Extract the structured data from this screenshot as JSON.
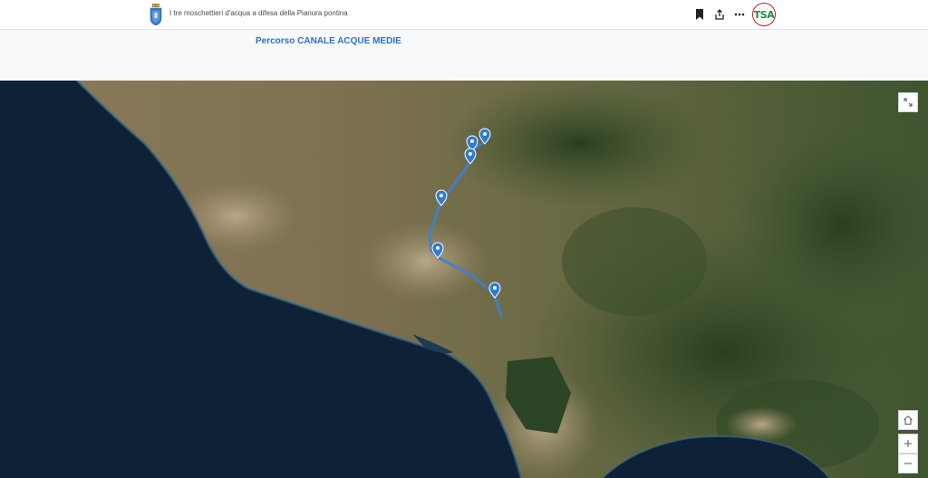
{
  "header": {
    "site_title": "I tre moschettieri d'acqua a difesa della Pianura pontina",
    "logo_text": "TSA",
    "icons": [
      "bookmark-icon",
      "share-icon",
      "more-icon"
    ]
  },
  "story": {
    "route_title": "Percorso CANALE ACQUE MEDIE"
  },
  "map": {
    "route_color": "#3d7fd6",
    "marker_color": "#2f7ad8",
    "sea_color": "#0e2137",
    "controls": [
      "expand-icon",
      "home-icon",
      "zoom-in-icon",
      "zoom-out-icon"
    ]
  }
}
